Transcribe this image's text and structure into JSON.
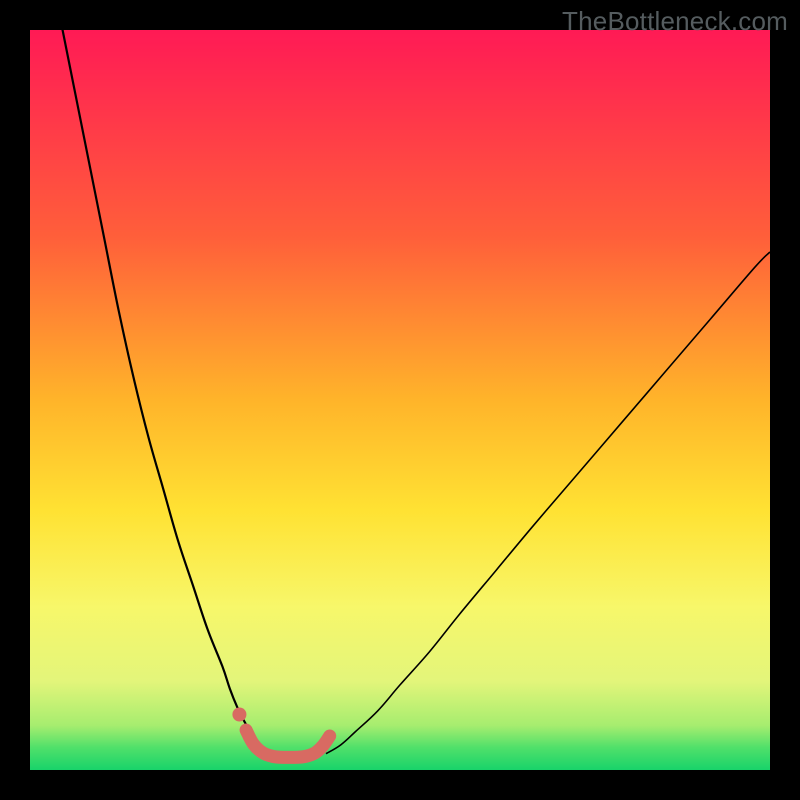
{
  "watermark": "TheBottleneck.com",
  "chart_data": {
    "type": "line",
    "title": "",
    "xlabel": "",
    "ylabel": "",
    "xlim": [
      0,
      100
    ],
    "ylim": [
      0,
      100
    ],
    "gradient_stops": [
      {
        "offset": 0,
        "color": "#ff1a55"
      },
      {
        "offset": 28,
        "color": "#ff5f3a"
      },
      {
        "offset": 50,
        "color": "#ffb42a"
      },
      {
        "offset": 65,
        "color": "#ffe233"
      },
      {
        "offset": 78,
        "color": "#f7f76a"
      },
      {
        "offset": 88,
        "color": "#e3f57a"
      },
      {
        "offset": 94,
        "color": "#a6ed6f"
      },
      {
        "offset": 97,
        "color": "#4fe06a"
      },
      {
        "offset": 100,
        "color": "#18d36a"
      }
    ],
    "series": [
      {
        "name": "left-curve",
        "x": [
          4,
          6,
          8,
          10,
          12,
          14,
          16,
          18,
          20,
          22,
          24,
          26,
          27,
          28,
          29,
          30,
          31,
          32
        ],
        "y": [
          102,
          92,
          82,
          72,
          62,
          53,
          45,
          38,
          31,
          25,
          19,
          14,
          11,
          8.5,
          6.5,
          4.8,
          3.3,
          2.2
        ]
      },
      {
        "name": "right-curve",
        "x": [
          40,
          42,
          44,
          47,
          50,
          54,
          58,
          63,
          68,
          74,
          80,
          86,
          92,
          98,
          100
        ],
        "y": [
          2.2,
          3.4,
          5.2,
          8,
          11.5,
          16,
          21,
          27,
          33,
          40,
          47,
          54,
          61,
          68,
          70
        ]
      },
      {
        "name": "trough-marker",
        "x": [
          29.2,
          30.2,
          31.5,
          33.0,
          35.0,
          37.0,
          38.5,
          39.6,
          40.5
        ],
        "y": [
          5.4,
          3.5,
          2.3,
          1.8,
          1.7,
          1.8,
          2.3,
          3.3,
          4.6
        ]
      },
      {
        "name": "trough-dot",
        "x": [
          28.3
        ],
        "y": [
          7.5
        ]
      }
    ]
  }
}
